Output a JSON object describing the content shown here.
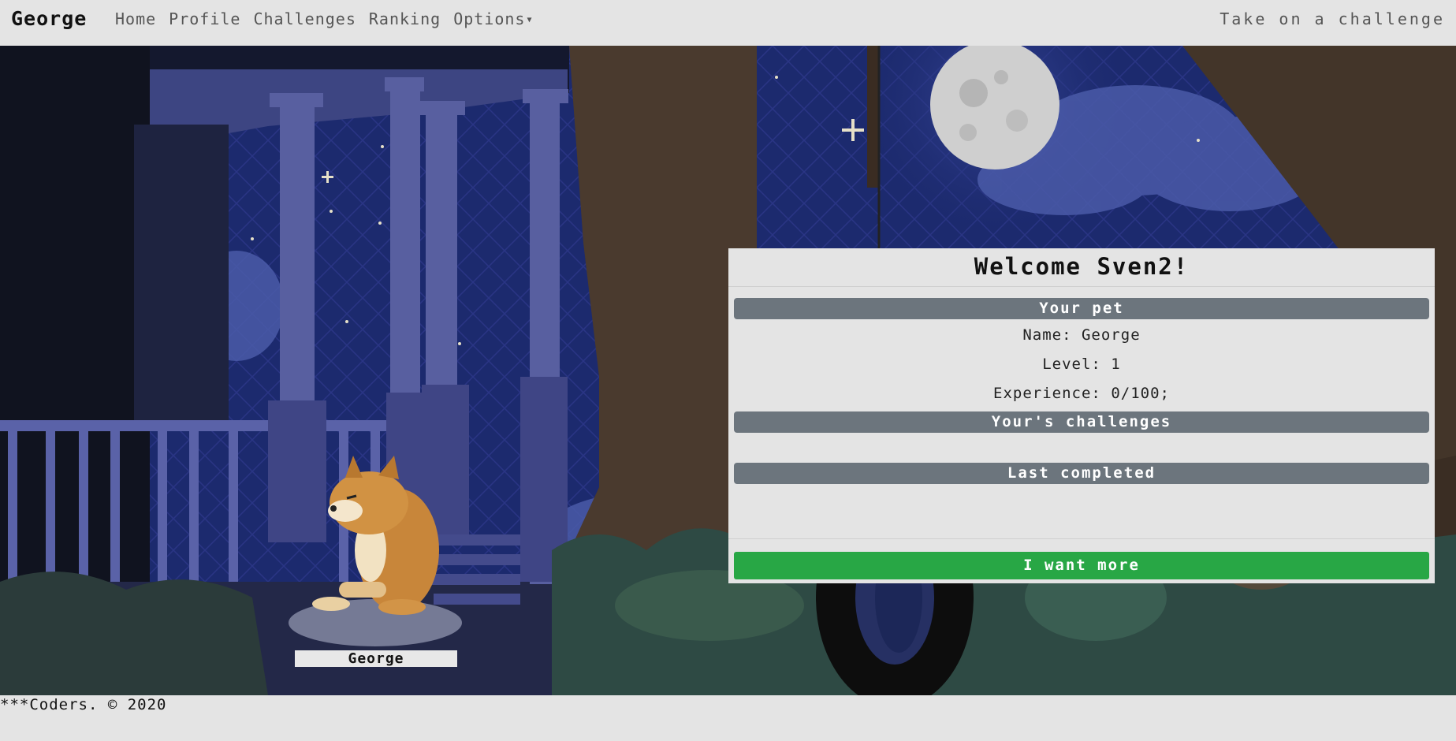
{
  "navbar": {
    "brand": "George",
    "links": [
      "Home",
      "Profile",
      "Challenges",
      "Ranking",
      "Options"
    ],
    "right_link": "Take on a challenge"
  },
  "card": {
    "title": "Welcome Sven2!",
    "pet_section": "Your pet",
    "name_label": "Name: George",
    "level_label": "Level: 1",
    "experience_label": "Experience: 0/100;",
    "challenges_section": "Your's challenges",
    "last_completed_section": "Last completed",
    "more_button": "I want more"
  },
  "pet": {
    "name_tag": "George"
  },
  "footer": {
    "text": "***Coders. © 2020"
  },
  "colors": {
    "success": "#28a745",
    "secondary": "#6c757d",
    "night_sky": "#1c2a6e"
  }
}
